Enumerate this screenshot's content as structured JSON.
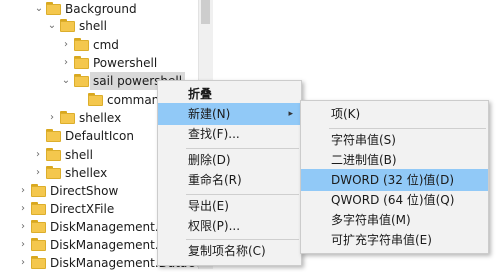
{
  "tree": {
    "items": [
      {
        "label": "Background",
        "expanded": true,
        "has_children": true
      },
      {
        "label": "shell",
        "expanded": true,
        "has_children": true
      },
      {
        "label": "cmd",
        "expanded": false,
        "has_children": true
      },
      {
        "label": "Powershell",
        "expanded": false,
        "has_children": true
      },
      {
        "label": "sail powershell",
        "expanded": true,
        "has_children": true,
        "selected": true
      },
      {
        "label": "command",
        "expanded": false,
        "has_children": false
      },
      {
        "label": "shellex",
        "expanded": false,
        "has_children": true
      },
      {
        "label": "DefaultIcon",
        "expanded": false,
        "has_children": false
      },
      {
        "label": "shell",
        "expanded": false,
        "has_children": true
      },
      {
        "label": "shellex",
        "expanded": false,
        "has_children": true
      },
      {
        "label": "DirectShow",
        "expanded": false,
        "has_children": true
      },
      {
        "label": "DirectXFile",
        "expanded": false,
        "has_children": true
      },
      {
        "label": "DiskManagement.Co",
        "expanded": false,
        "has_children": true
      },
      {
        "label": "DiskManagement.Co",
        "expanded": false,
        "has_children": true
      },
      {
        "label": "DiskManagement.DataObject",
        "expanded": false,
        "has_children": true
      }
    ]
  },
  "context_menu": {
    "items": [
      {
        "label": "折叠",
        "bold": true
      },
      {
        "label": "新建(N)",
        "highlighted": true,
        "has_submenu": true
      },
      {
        "label": "查找(F)..."
      },
      {
        "label": "删除(D)"
      },
      {
        "label": "重命名(R)"
      },
      {
        "label": "导出(E)"
      },
      {
        "label": "权限(P)..."
      },
      {
        "label": "复制项名称(C)"
      }
    ]
  },
  "submenu": {
    "items": [
      {
        "label": "项(K)"
      },
      {
        "label": "字符串值(S)"
      },
      {
        "label": "二进制值(B)"
      },
      {
        "label": "DWORD (32 位)值(D)",
        "highlighted": true
      },
      {
        "label": "QWORD (64 位)值(Q)"
      },
      {
        "label": "多字符串值(M)"
      },
      {
        "label": "可扩充字符串值(E)"
      }
    ]
  },
  "colors": {
    "folder": "#f4c74d",
    "highlight": "#91c9f7",
    "menu_bg": "#f2f2f2"
  }
}
